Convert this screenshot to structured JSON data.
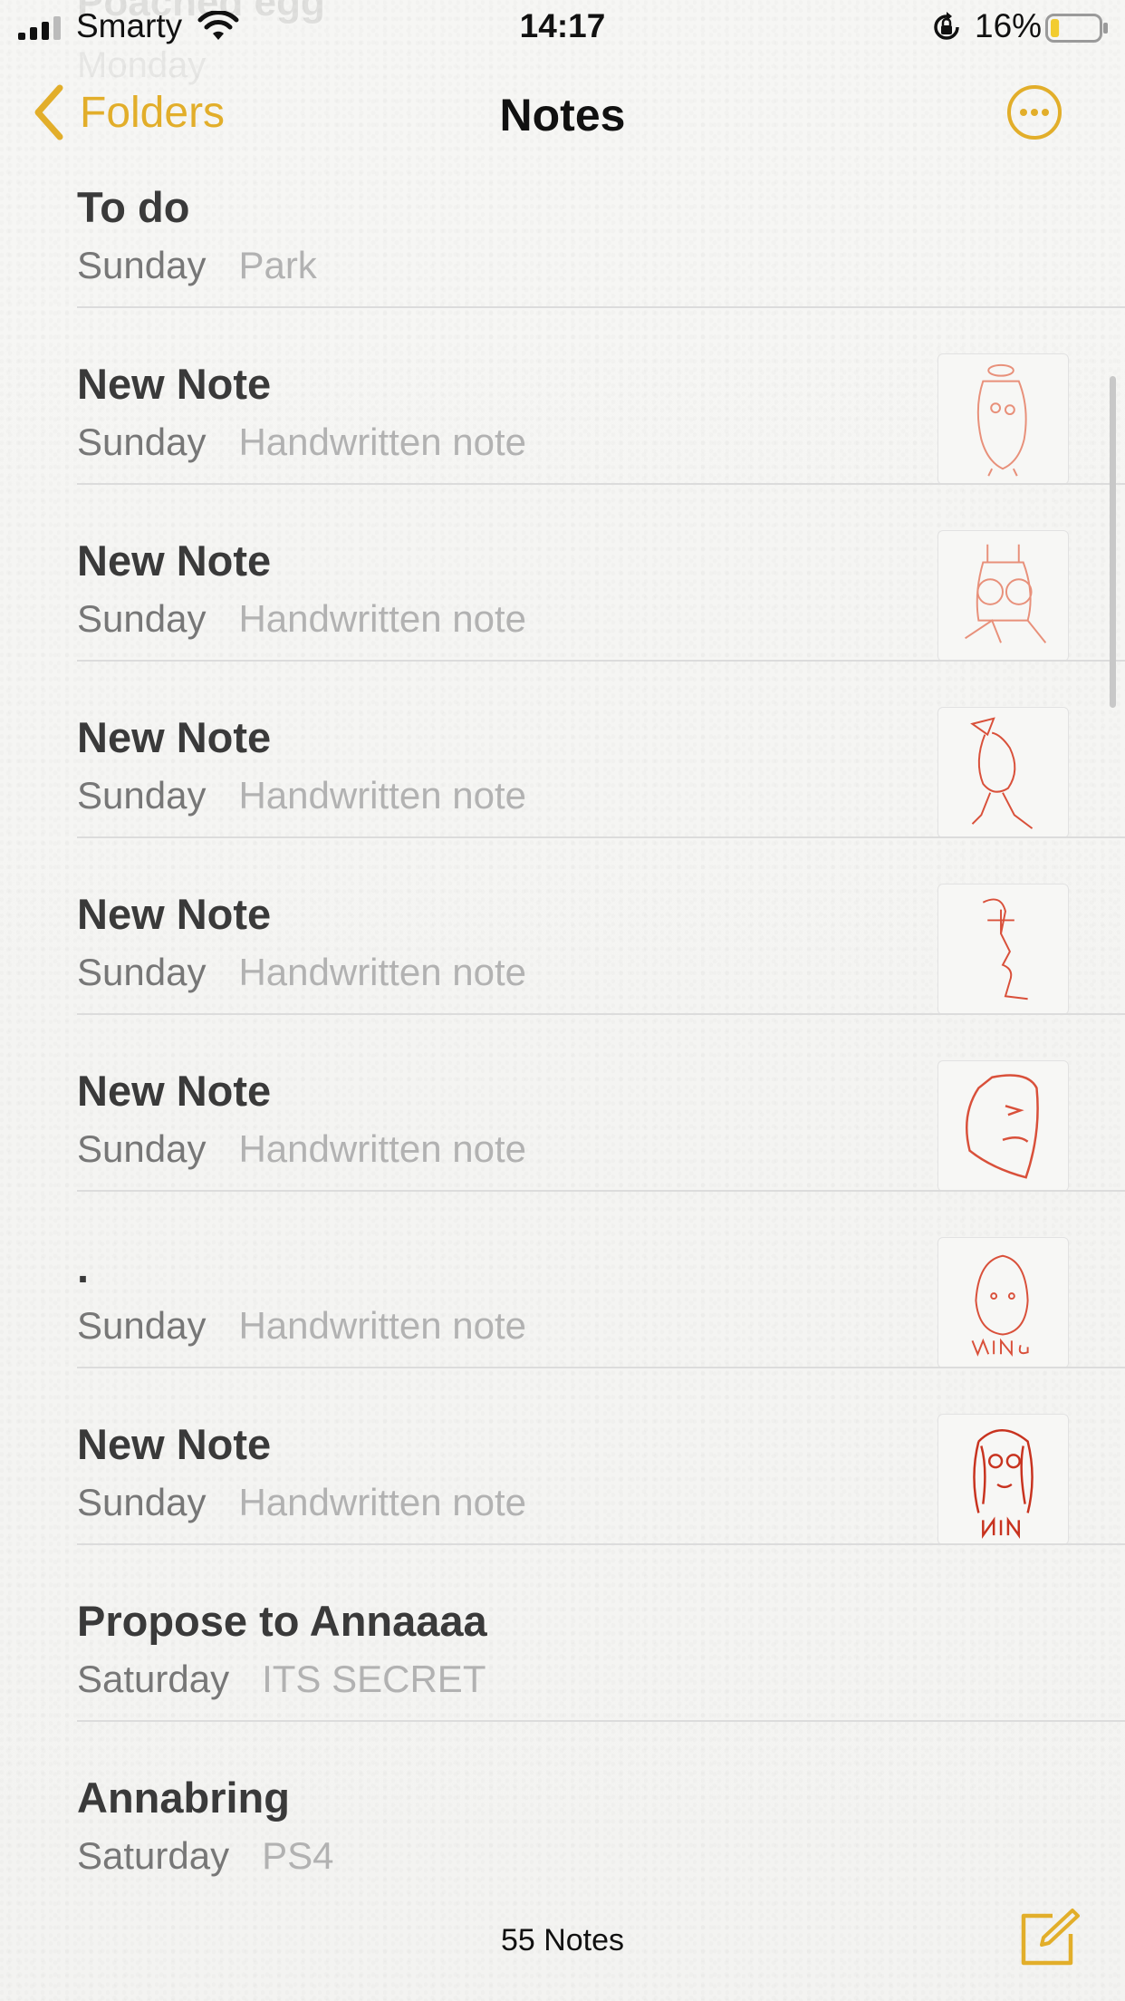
{
  "status_bar": {
    "carrier": "Smarty",
    "time": "14:17",
    "battery_percent": "16%",
    "battery_level": 0.16,
    "ghost_title": "Poached egg",
    "ghost_subtitle": "Monday"
  },
  "nav": {
    "back_label": "Folders",
    "title": "Notes",
    "accent_color": "#e2ae2a"
  },
  "notes": [
    {
      "title": "To do",
      "date": "Sunday",
      "preview": "Park",
      "thumbnail": null
    },
    {
      "title": "New Note",
      "date": "Sunday",
      "preview": "Handwritten note",
      "thumbnail": "sketch-figure-1"
    },
    {
      "title": "New Note",
      "date": "Sunday",
      "preview": "Handwritten note",
      "thumbnail": "sketch-figure-2"
    },
    {
      "title": "New Note",
      "date": "Sunday",
      "preview": "Handwritten note",
      "thumbnail": "sketch-walking-figure"
    },
    {
      "title": "New Note",
      "date": "Sunday",
      "preview": "Handwritten note",
      "thumbnail": "sketch-face-profile"
    },
    {
      "title": "New Note",
      "date": "Sunday",
      "preview": "Handwritten note",
      "thumbnail": "sketch-face-outline"
    },
    {
      "title": ".",
      "date": "Sunday",
      "preview": "Handwritten note",
      "thumbnail": "sketch-egg-face"
    },
    {
      "title": "New Note",
      "date": "Sunday",
      "preview": "Handwritten note",
      "thumbnail": "sketch-girl-portrait"
    },
    {
      "title": "Propose to Annaaaa",
      "date": "Saturday",
      "preview": "ITS SECRET",
      "thumbnail": null
    },
    {
      "title": "Annabring",
      "date": "Saturday",
      "preview": "PS4",
      "thumbnail": null
    }
  ],
  "bottom_bar": {
    "notes_count": "55 Notes"
  }
}
